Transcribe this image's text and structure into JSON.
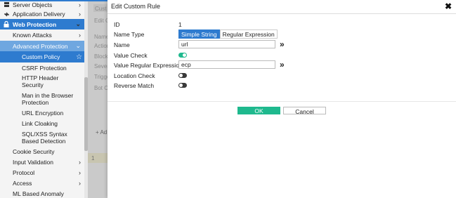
{
  "sidebar": {
    "items": [
      {
        "label": "Server Objects",
        "chevron": ">"
      },
      {
        "label": "Application Delivery",
        "chevron": ">"
      },
      {
        "label": "Web Protection",
        "chevron": "v"
      },
      {
        "label": "Known Attacks",
        "chevron": ">"
      },
      {
        "label": "Advanced Protection",
        "chevron": "v"
      },
      {
        "label": "Custom Policy"
      },
      {
        "label": "CSRF Protection"
      },
      {
        "label": "HTTP Header Security"
      },
      {
        "label": "Man in the Browser Protection"
      },
      {
        "label": "URL Encryption"
      },
      {
        "label": "Link Cloaking"
      },
      {
        "label": "SQL/XSS Syntax Based Detection"
      },
      {
        "label": "Cookie Security"
      },
      {
        "label": "Input Validation",
        "chevron": ">"
      },
      {
        "label": "Protocol",
        "chevron": ">"
      },
      {
        "label": "Access",
        "chevron": ">"
      },
      {
        "label": "ML Based Anomaly"
      }
    ]
  },
  "background": {
    "tab": "Cust",
    "edit_label": "Edit C",
    "rows": [
      "Name",
      "Action",
      "Block",
      "Sever",
      "Trigge",
      "Bot C"
    ],
    "add_label": "+ Ad",
    "row_value": "1"
  },
  "modal": {
    "title": "Edit Custom Rule",
    "close": "✖",
    "fields": {
      "id_label": "ID",
      "id_value": "1",
      "name_type_label": "Name Type",
      "name_type_options": [
        "Simple String",
        "Regular Expression"
      ],
      "name_label": "Name",
      "name_value": "url",
      "value_check_label": "Value Check",
      "value_regex_label": "Value Regular Expression",
      "value_regex_value": "ecp",
      "location_check_label": "Location Check",
      "reverse_match_label": "Reverse Match"
    },
    "ok_label": "OK",
    "cancel_label": "Cancel",
    "expand_glyph": "»"
  }
}
